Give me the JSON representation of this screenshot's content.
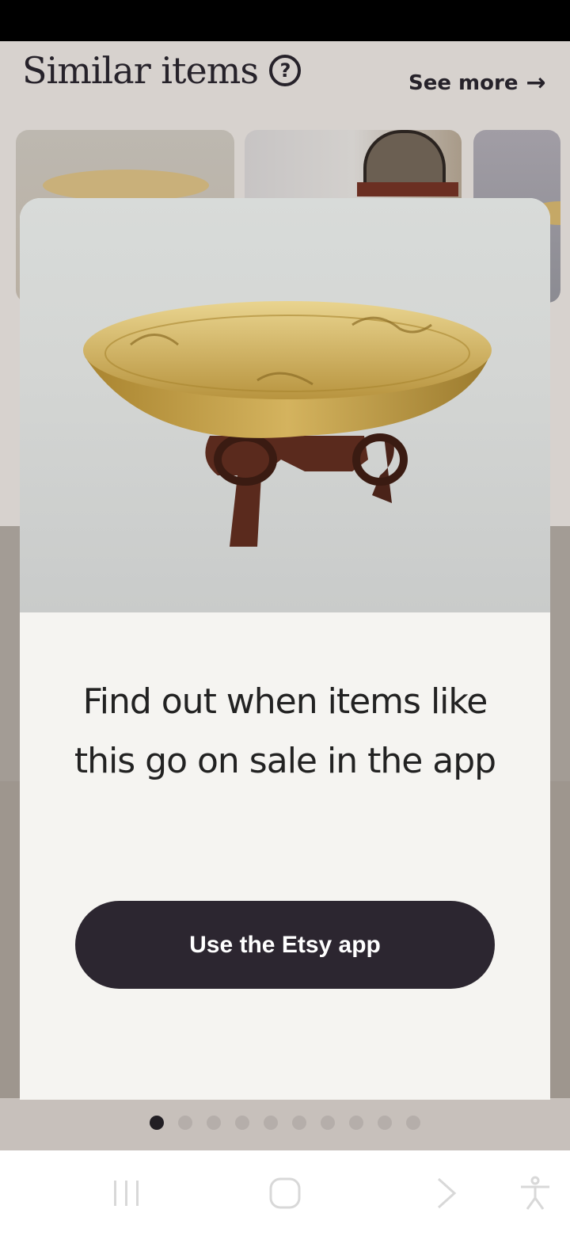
{
  "section": {
    "title": "Similar items",
    "see_more": "See more"
  },
  "modal": {
    "title": "Find out when items like this go on sale in the app",
    "cta_label": "Use the Etsy app"
  },
  "pager": {
    "total": 10,
    "active_index": 0
  },
  "navigation": {
    "recent_apps": "recent-apps-icon",
    "home": "home-icon",
    "back": "back-icon",
    "accessibility": "accessibility-icon"
  }
}
